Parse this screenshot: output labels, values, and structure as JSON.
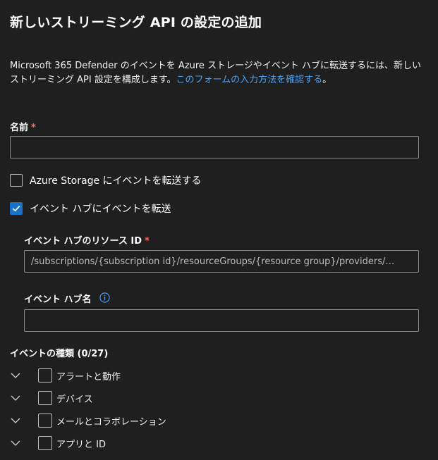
{
  "panel": {
    "title": "新しいストリーミング API の設定の追加",
    "description": "Microsoft 365 Defender のイベントを Azure ストレージやイベント ハブに転送するには、新しいストリーミング API 設定を構成します。",
    "description_link": "このフォームの入力方法を確認する",
    "description_end": "。"
  },
  "name_field": {
    "label": "名前",
    "required_mark": "*",
    "value": ""
  },
  "azure_storage": {
    "label": "Azure Storage にイベントを転送する",
    "checked": false
  },
  "event_hub": {
    "label": "イベント ハブにイベントを転送",
    "checked": true,
    "resource_id": {
      "label": "イベント ハブのリソース ID",
      "required_mark": "*",
      "placeholder": "/subscriptions/{subscription id}/resourceGroups/{resource group}/providers/…"
    },
    "hub_name": {
      "label": "イベント ハブ名",
      "value": ""
    }
  },
  "event_types": {
    "title": "イベントの種類 (0/27)",
    "items": [
      {
        "label": "アラートと動作",
        "checked": false
      },
      {
        "label": "デバイス",
        "checked": false
      },
      {
        "label": "メールとコラボレーション",
        "checked": false
      },
      {
        "label": "アプリと ID",
        "checked": false
      }
    ]
  },
  "colors": {
    "background": "#1f1f1f",
    "accent": "#1b73c8",
    "link": "#4aa3f5",
    "required": "#ff6b5e"
  }
}
